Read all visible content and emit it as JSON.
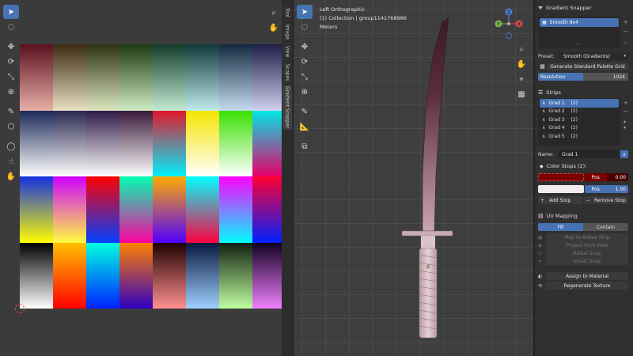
{
  "left_editor": {
    "toolbar_icons": [
      "cursor-icon",
      "circle-select-icon",
      "move-icon",
      "rotate-icon",
      "scale-icon",
      "transform-icon",
      "annotate-icon",
      "cube-icon",
      "lasso-icon",
      "grab-icon",
      "pinch-icon"
    ],
    "nav_icons": [
      "zoom-icon",
      "hand-icon"
    ],
    "side_tabs": [
      "Tool",
      "Image",
      "View",
      "Scopes",
      "Gradient Snapper"
    ],
    "palette_rows": [
      [
        [
          "#5a0f1e",
          "#e8b0a8"
        ],
        [
          "#3b2a12",
          "#eae0c4"
        ],
        [
          "#2d3212",
          "#dde8c0"
        ],
        [
          "#1c3a12",
          "#d0ecc4"
        ],
        [
          "#123c2a",
          "#c4ecd6"
        ],
        [
          "#0e3a3a",
          "#c0ecec"
        ],
        [
          "#142a40",
          "#c4dcf0"
        ],
        [
          "#1e1e48",
          "#d0d0f0"
        ]
      ],
      [
        [
          "#1c2a58",
          "#ffffff"
        ],
        [
          "#2a2850",
          "#ffffff"
        ],
        [
          "#2e1a48",
          "#ffffff"
        ],
        [
          "#3a1a3a",
          "#ffffff"
        ],
        [
          "#e0182a",
          "#00f0ff"
        ],
        [
          "#f5e400",
          "#ffffff"
        ],
        [
          "#38e000",
          "#ffffff"
        ],
        [
          "#00e6e6",
          "#e8006a"
        ]
      ],
      [
        [
          "#1430e0",
          "#ffff00"
        ],
        [
          "#d000ff",
          "#ffff40"
        ],
        [
          "#ff0000",
          "#0040ff"
        ],
        [
          "#00ffb0",
          "#ff00a0"
        ],
        [
          "#ffaa00",
          "#5000ff"
        ],
        [
          "#00ffff",
          "#ff0040"
        ],
        [
          "#ff00ff",
          "#00ffff"
        ],
        [
          "#ff0030",
          "#0020ff"
        ]
      ],
      [
        [
          "#000000",
          "#ffffff"
        ],
        [
          "#ffc000",
          "#ff0000"
        ],
        [
          "#00ffe0",
          "#0020ff"
        ],
        [
          "#ff8000",
          "#3000c0"
        ],
        [
          "#200000",
          "#ff9090"
        ],
        [
          "#081840",
          "#a0d0ff"
        ],
        [
          "#102010",
          "#c0ffa0"
        ],
        [
          "#100020",
          "#f080ff"
        ]
      ]
    ]
  },
  "viewport": {
    "view_name": "Left Orthographic",
    "collection": "(1) Collection | group1141768986",
    "units": "Meters",
    "gizmo_labels": [
      "Y",
      "Z",
      "X"
    ],
    "toolbar_icons": [
      "cursor-icon",
      "circle-select-icon",
      "move-icon",
      "rotate-icon",
      "scale-icon",
      "transform-icon",
      "annotate-icon",
      "measure-icon",
      "add-cube-icon"
    ],
    "nav_icons": [
      "zoom-icon",
      "hand-icon",
      "camera-icon",
      "grid-icon"
    ]
  },
  "npanel": {
    "title": "Gradient Snapper",
    "palette_list_item": "Smooth 8x4",
    "preset_label": "Preset:",
    "preset_value": "Smooth (Gradients)",
    "generate_label": "Generate Standard Palette Grid",
    "resolution_label": "Resolution",
    "resolution_value": "1024",
    "strips_label": "Strips",
    "strips": [
      {
        "name": "Grad 1",
        "count": "(2)"
      },
      {
        "name": "Grad 2",
        "count": "(2)"
      },
      {
        "name": "Grad 3",
        "count": "(2)"
      },
      {
        "name": "Grad 4",
        "count": "(2)"
      },
      {
        "name": "Grad 5",
        "count": "(2)"
      }
    ],
    "name_label": "Name:",
    "name_value": "Grad 1",
    "color_stops_label": "Color Stops (2):",
    "stops": [
      {
        "pos_label": "Pos",
        "pos_value": "0.00",
        "color": "#7a0000"
      },
      {
        "pos_label": "Pos",
        "pos_value": "1.00",
        "color": "#f3ecec"
      }
    ],
    "add_stop_label": "Add Stop",
    "remove_stop_label": "Remove Stop",
    "uv_mapping_label": "UV Mapping",
    "fill_label": "Fill",
    "contain_label": "Contain",
    "map_active_label": "Map to Active Strip",
    "project_view_label": "Project from View",
    "radial_snap_label": "Radial Snap",
    "smart_snap_label": "Smart Snap",
    "assign_label": "Assign to Material",
    "regenerate_label": "Regenerate Texture",
    "accent_color": "#4772b3"
  }
}
